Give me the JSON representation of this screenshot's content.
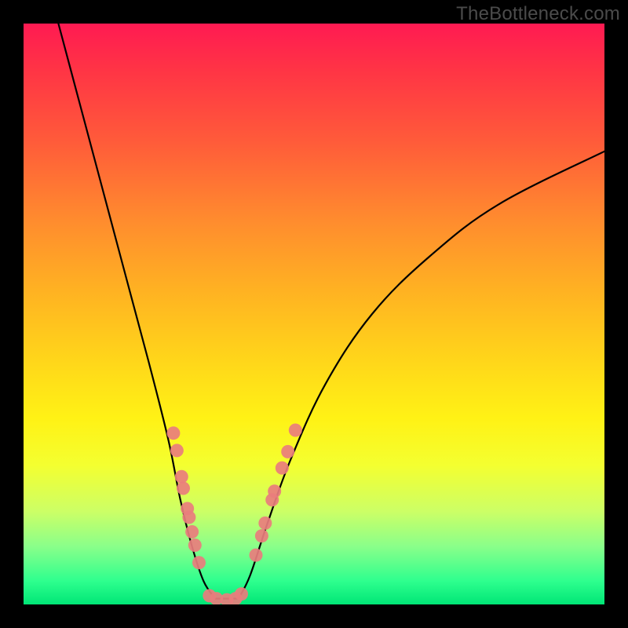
{
  "attribution": "TheBottleneck.com",
  "chart_data": {
    "type": "line",
    "title": "",
    "xlabel": "",
    "ylabel": "",
    "xlim": [
      0,
      100
    ],
    "ylim": [
      0,
      100
    ],
    "series": [
      {
        "name": "curve-left",
        "values": [
          {
            "x": 6,
            "y": 100
          },
          {
            "x": 10,
            "y": 85
          },
          {
            "x": 14,
            "y": 70
          },
          {
            "x": 18,
            "y": 55
          },
          {
            "x": 22,
            "y": 40
          },
          {
            "x": 25,
            "y": 28
          },
          {
            "x": 27,
            "y": 18
          },
          {
            "x": 29,
            "y": 10
          },
          {
            "x": 31,
            "y": 4
          },
          {
            "x": 33,
            "y": 1
          }
        ]
      },
      {
        "name": "curve-right",
        "values": [
          {
            "x": 37,
            "y": 1
          },
          {
            "x": 39,
            "y": 5
          },
          {
            "x": 42,
            "y": 14
          },
          {
            "x": 46,
            "y": 25
          },
          {
            "x": 52,
            "y": 38
          },
          {
            "x": 60,
            "y": 50
          },
          {
            "x": 70,
            "y": 60
          },
          {
            "x": 82,
            "y": 69
          },
          {
            "x": 100,
            "y": 78
          }
        ]
      },
      {
        "name": "bottom-flat",
        "values": [
          {
            "x": 33,
            "y": 1
          },
          {
            "x": 37,
            "y": 1
          }
        ]
      }
    ],
    "markers": [
      {
        "x": 25.8,
        "y": 29.5
      },
      {
        "x": 26.4,
        "y": 26.5
      },
      {
        "x": 27.2,
        "y": 22.0
      },
      {
        "x": 27.5,
        "y": 20.0
      },
      {
        "x": 28.2,
        "y": 16.5
      },
      {
        "x": 28.5,
        "y": 15.0
      },
      {
        "x": 29.0,
        "y": 12.5
      },
      {
        "x": 29.5,
        "y": 10.2
      },
      {
        "x": 30.2,
        "y": 7.2
      },
      {
        "x": 32.0,
        "y": 1.5
      },
      {
        "x": 33.2,
        "y": 1.0
      },
      {
        "x": 35.0,
        "y": 0.8
      },
      {
        "x": 36.5,
        "y": 1.0
      },
      {
        "x": 37.5,
        "y": 1.8
      },
      {
        "x": 40.0,
        "y": 8.5
      },
      {
        "x": 41.0,
        "y": 11.8
      },
      {
        "x": 41.6,
        "y": 14.0
      },
      {
        "x": 42.8,
        "y": 18.0
      },
      {
        "x": 43.2,
        "y": 19.5
      },
      {
        "x": 44.5,
        "y": 23.5
      },
      {
        "x": 45.5,
        "y": 26.3
      },
      {
        "x": 46.8,
        "y": 30.0
      }
    ],
    "marker_color": "#e97d7d",
    "curve_color": "#000000"
  }
}
